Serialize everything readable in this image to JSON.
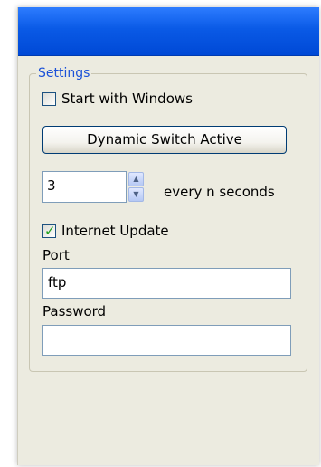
{
  "window": {
    "title": ""
  },
  "settings": {
    "group_label": "Settings",
    "start_with_windows": {
      "label": "Start with Windows",
      "checked": false
    },
    "dynamic_switch_button": "Dynamic Switch Active",
    "interval": {
      "value": "3",
      "suffix": "every n seconds"
    },
    "internet_update": {
      "label": "Internet Update",
      "checked": true
    },
    "port": {
      "label": "Port",
      "value": "ftp"
    },
    "password": {
      "label": "Password",
      "value": ""
    }
  },
  "icons": {
    "spin_up": "arrow-up-icon",
    "spin_down": "arrow-down-icon",
    "checkmark": "checkmark-icon"
  },
  "colors": {
    "titlebar": "#0a5ae6",
    "group_label": "#1c52d8",
    "window_bg": "#ecebe0",
    "checkmark": "#21a121"
  }
}
